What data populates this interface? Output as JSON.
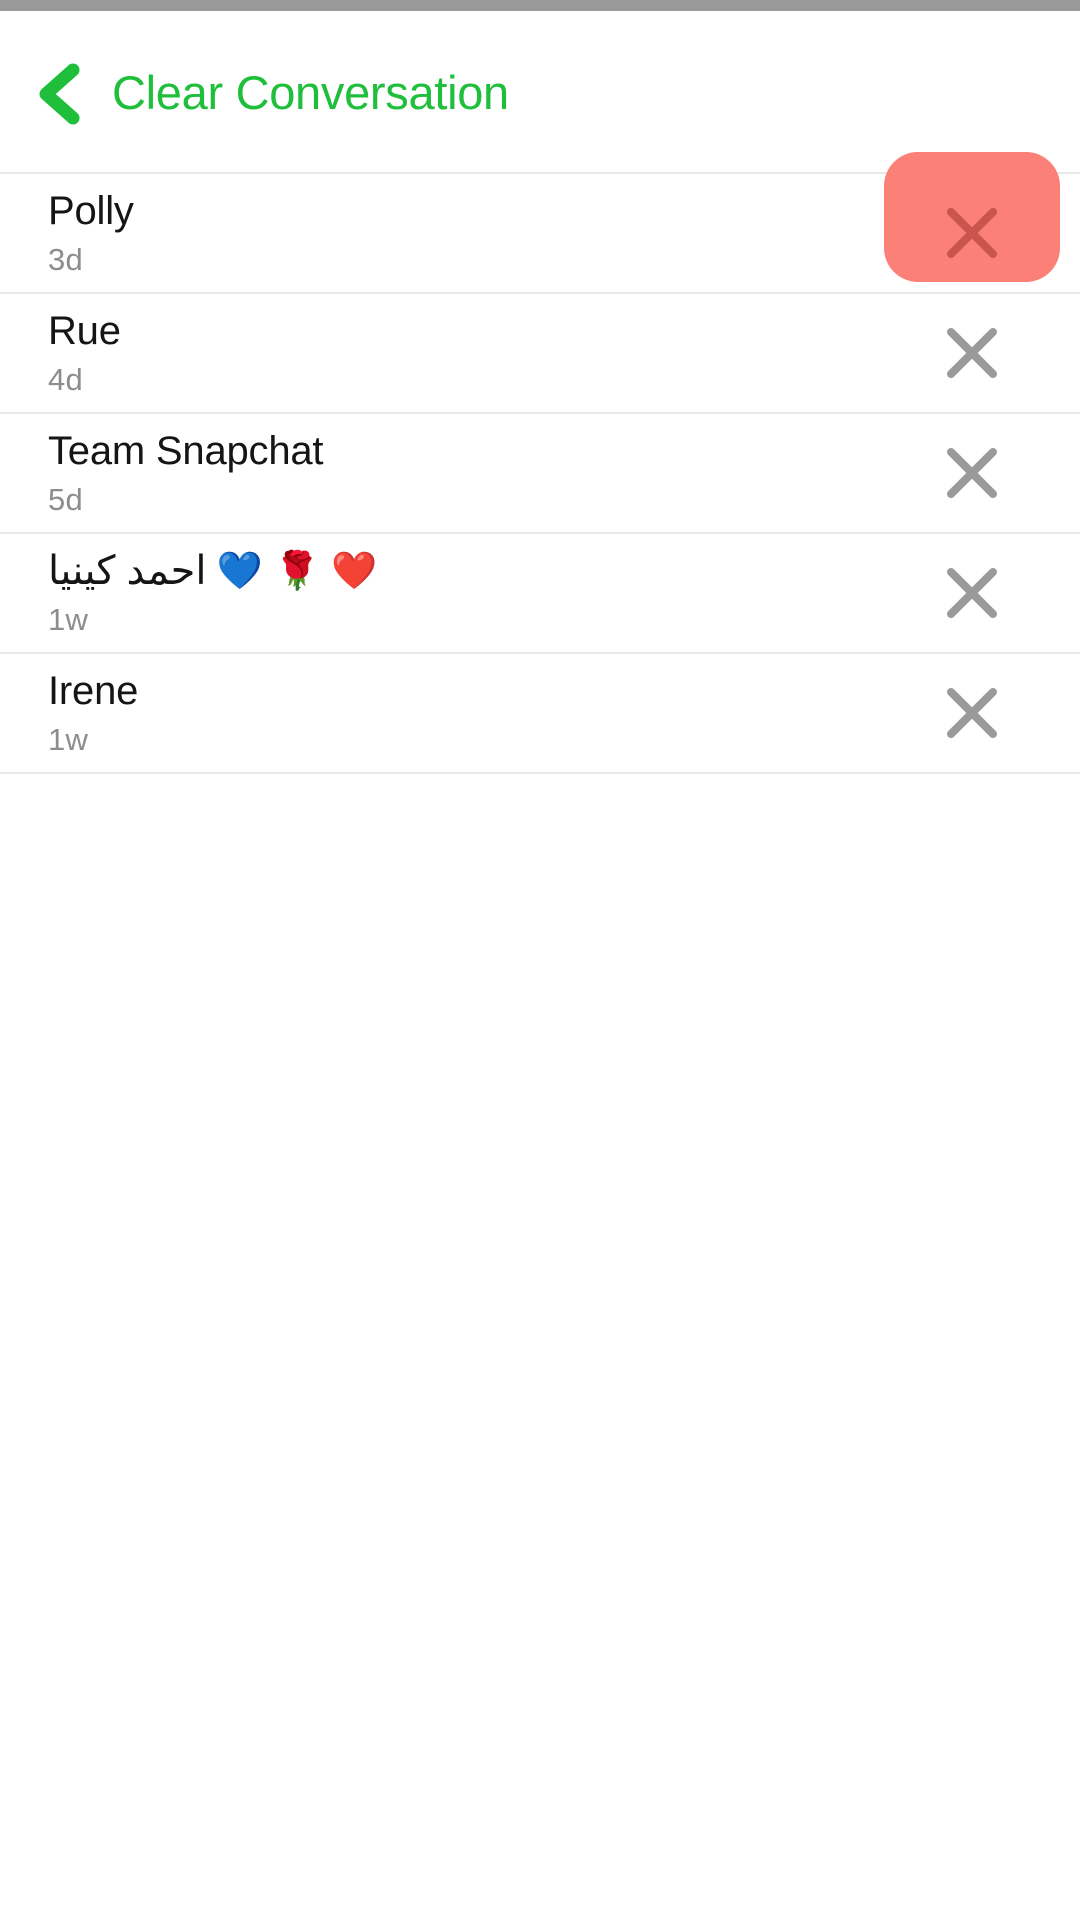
{
  "status_bar": {
    "color": "#9a9a9a"
  },
  "header": {
    "title": "Clear Conversation",
    "back_icon": "chevron-left-icon",
    "accent_color": "#1fbf3c"
  },
  "colors": {
    "accent_green": "#1fbf3c",
    "pressed_red_bg": "#fb8178",
    "pressed_red_icon": "#c9554e",
    "icon_gray": "#9a9a9a",
    "divider": "#e9e9e9",
    "name_text": "#151515",
    "time_text": "#8d8d8d"
  },
  "list": {
    "delete_icon": "close-x-icon",
    "rows": [
      {
        "name": "Polly",
        "emoji": "",
        "time": "3d",
        "pressed": true
      },
      {
        "name": "Rue",
        "emoji": "",
        "time": "4d",
        "pressed": false
      },
      {
        "name": "Team Snapchat",
        "emoji": "",
        "time": "5d",
        "pressed": false
      },
      {
        "name": "احمد كينيا",
        "emoji": "💙 🌹 ❤️",
        "time": "1w",
        "pressed": false
      },
      {
        "name": "Irene",
        "emoji": "",
        "time": "1w",
        "pressed": false
      }
    ]
  }
}
